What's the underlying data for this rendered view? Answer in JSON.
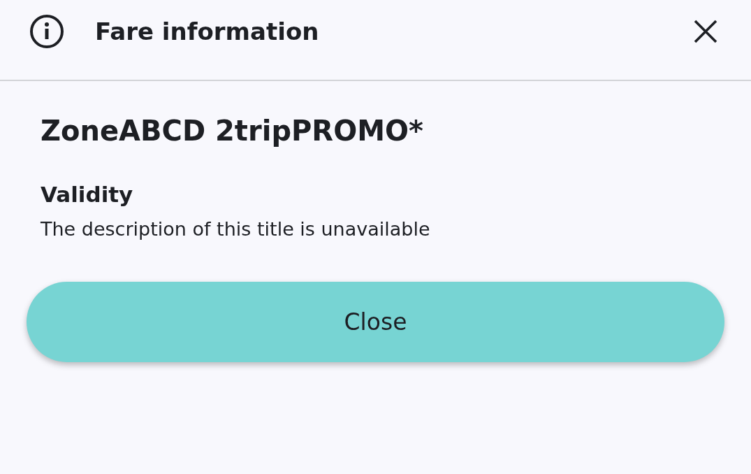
{
  "header": {
    "title": "Fare information"
  },
  "fare": {
    "name": "ZoneABCD 2tripPROMO*",
    "section_title": "Validity",
    "description": "The description of this title is unavailable"
  },
  "buttons": [
    "Close"
  ]
}
